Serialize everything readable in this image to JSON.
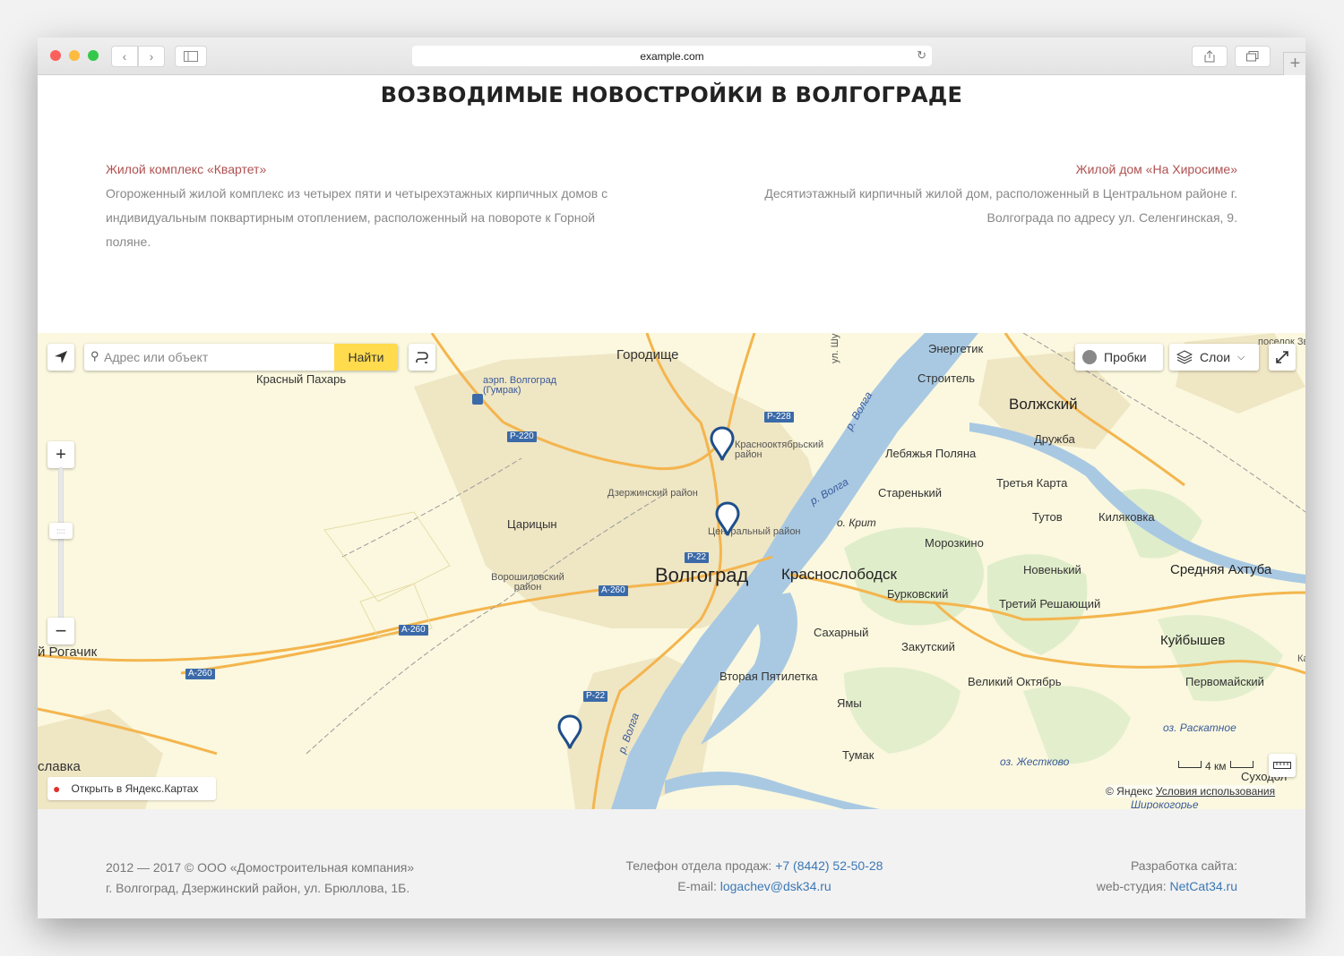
{
  "browser": {
    "url": "example.com"
  },
  "page": {
    "heading": "ВОЗВОДИМЫЕ НОВОСТРОЙКИ В ВОЛГОГРАДЕ",
    "projects": [
      {
        "title": "Жилой комплекс «Квартет»",
        "desc_lines": [
          "Огороженный жилой комплекс из четырех пяти и четырехэтажных кирпичных домов с",
          "индивидуальным поквартирным отоплением, расположенный на повороте к Горной",
          "поляне."
        ]
      },
      {
        "title": "Жилой дом «На Хиросиме»",
        "desc_lines": [
          "Десятиэтажный кирпичный жилой дом, расположенный в Центральном районе г.",
          "Волгограда по адресу ул. Селенгинская, 9."
        ]
      }
    ]
  },
  "map": {
    "search_placeholder": "Адрес или объект",
    "find_label": "Найти",
    "traffic_label": "Пробки",
    "layers_label": "Слои",
    "open_in_maps": "Открыть в Яндекс.Картах",
    "scale_label": "4 км",
    "copyright": "© Яндекс",
    "terms": "Условия использования",
    "labels": {
      "volgograd": "Волгоград",
      "krasnoslobodsk": "Краснослободск",
      "volzhsky": "Волжский",
      "gorodishche": "Городище",
      "sredn_akhtuba": "Средняя Ахтуба",
      "kuibyshev": "Куйбышев",
      "krasny_pakhar": "Красный Пахарь",
      "aero": "аэрп. Волгоград (Гумрак)",
      "krasnooktyabrsky": "Краснооктябрьский район",
      "dzerzhinsky": "Дзержинский район",
      "tsaritsyn": "Царицын",
      "tsentralny": "Центральный район",
      "voroshilovsky": "Ворошиловский район",
      "rogachik": "й Рогачик",
      "slavka": "славка",
      "energetik": "Энергетик",
      "stroitel": "Строитель",
      "druzhba": "Дружба",
      "lebyazhya": "Лебяжья Поляна",
      "starenky": "Старенький",
      "tretya_karta": "Третья Карта",
      "tutov": "Тутов",
      "kilyakovka": "Киляковка",
      "o_krit": "о. Крит",
      "morozkino": "Морозкино",
      "novenky": "Новенький",
      "burkovsky": "Бурковский",
      "treti_reshayushchy": "Третий Решающий",
      "sakharny": "Сахарный",
      "zakutsky": "Закутский",
      "vtoraya_pyatiletka": "Вторая Пятилетка",
      "veliky_oktyabr": "Великий Октябрь",
      "pervomaisky": "Первомайский",
      "yamy": "Ямы",
      "tumak": "Тумак",
      "oz_raskatnoe": "оз. Раскатное",
      "oz_zhestkovo": "оз. Жестково",
      "sukhodol": "Суходол",
      "shirokogorye": "Широкогорье",
      "poselok": "поселок Зв",
      "r_volga_1": "р. Волга",
      "r_volga_2": "р. Волга",
      "r_volga_3": "р. Волга",
      "ul_shu": "ул. Шу",
      "ka": "Ка"
    },
    "roads": {
      "p220": "Р-220",
      "p228": "Р-228",
      "p22a": "Р-22",
      "p22b": "Р-22",
      "a260a": "А-260",
      "a260b": "А-260",
      "a260c": "А-260"
    },
    "colors": {
      "land": "#fbf8df",
      "urban": "#efe6c4",
      "water": "#a9c9e3",
      "road": "#f4b54e",
      "forest": "#d4e8c0",
      "pin": "#1f4e8a",
      "find_button": "#ffdb4d"
    }
  },
  "footer": {
    "copyright": "2012 — 2017 © ООО «Домостроительная компания»",
    "address": "г. Волгоград, Дзержинский район, ул. Брюллова, 1Б.",
    "phone_label": "Телефон отдела продаж: ",
    "phone": "+7 (8442) 52-50-28",
    "email_label": "E-mail: ",
    "email": "logachev@dsk34.ru",
    "dev_label": "Разработка сайта:",
    "studio_label": "web-студия: ",
    "studio": "NetCat34.ru"
  }
}
